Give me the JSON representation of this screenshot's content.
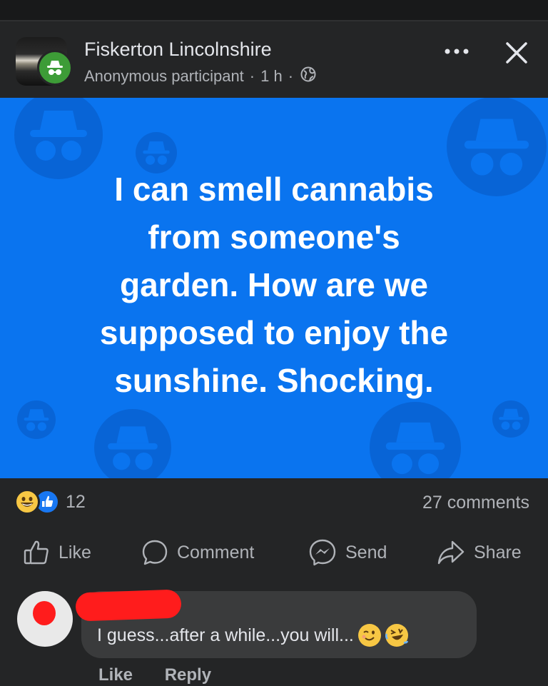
{
  "header": {
    "group_name": "Fiskerton Lincolnshire",
    "author": "Anonymous participant",
    "separator": "·",
    "time": "1 h",
    "privacy_icon": "globe-icon",
    "more_icon": "more-icon",
    "close_icon": "close-icon"
  },
  "post": {
    "text": "I can smell cannabis\nfrom someone's\ngarden.  How are we\nsupposed to enjoy the\nsunshine.  Shocking.",
    "background_color": "#0a74ef"
  },
  "stats": {
    "reactions": [
      "grinning-emoji",
      "like-icon"
    ],
    "reaction_count": "12",
    "comments_count": "27 comments"
  },
  "actions": {
    "like": "Like",
    "comment": "Comment",
    "send": "Send",
    "share": "Share"
  },
  "comment": {
    "author": "",
    "text": "I guess...after a while...you will...",
    "emojis": [
      "winking-face",
      "rolling-on-floor-laughing"
    ],
    "like": "Like",
    "reply": "Reply"
  }
}
